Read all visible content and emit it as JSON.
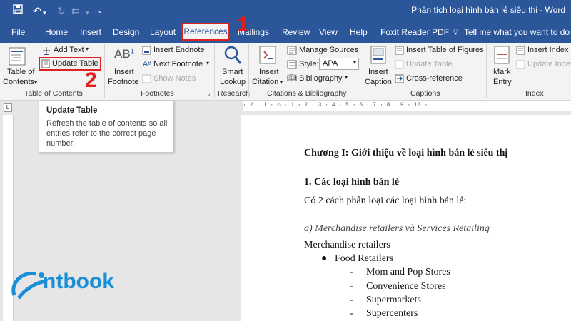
{
  "title_bar": {
    "document_title": "Phân tích loại hình bán lẻ siêu thị  -  Word"
  },
  "tabs": [
    "File",
    "Home",
    "Insert",
    "Design",
    "Layout",
    "References",
    "Mailings",
    "Review",
    "View",
    "Help",
    "Foxit Reader PDF"
  ],
  "tell_me": "Tell me what you want to do",
  "ribbon": {
    "toc": {
      "add_text": "Add Text",
      "update_table": "Update Table",
      "table_of_contents": [
        "Table of",
        "Contents"
      ],
      "group": "Table of Contents"
    },
    "footnotes": {
      "insert_footnote": [
        "Insert",
        "Footnote"
      ],
      "ab_icon": "AB",
      "insert_endnote": "Insert Endnote",
      "next_footnote": "Next Footnote",
      "show_notes": "Show Notes",
      "group": "Footnotes"
    },
    "research": {
      "smart_lookup": [
        "Smart",
        "Lookup"
      ],
      "group": "Research"
    },
    "citations": {
      "insert_citation": [
        "Insert",
        "Citation"
      ],
      "manage_sources": "Manage Sources",
      "style_label": "Style:",
      "style_value": "APA",
      "bibliography": "Bibliography",
      "group": "Citations & Bibliography"
    },
    "captions": {
      "insert_caption": [
        "Insert",
        "Caption"
      ],
      "insert_table_of_figures": "Insert Table of Figures",
      "update_table": "Update Table",
      "cross_reference": "Cross-reference",
      "group": "Captions"
    },
    "index": {
      "mark_entry": [
        "Mark",
        "Entry"
      ],
      "insert_index": "Insert Index",
      "update_index": "Update Index",
      "group": "Index"
    }
  },
  "tooltip": {
    "title": "Update Table",
    "description": "Refresh the table of contents so all entries refer to the correct page number."
  },
  "markers": {
    "step1": "1",
    "step2": "2"
  },
  "ruler_text": "· 2 · 1 · ⌂ · 1 · 2 · 3 · 4 · 5 · 6 · 7 · 8 · 9 · 10 · 1",
  "document": {
    "heading": "Chương I: Giới thiệu về loại hình bán lẻ siêu thị",
    "subheading": "1. Các loại hình bán lẻ",
    "intro": "Có 2 cách phân loại các loại hình bán lẻ:",
    "section_a": "a) Merchandise retailers và Services Retailing",
    "merch": "Merchandise retailers",
    "bullet": "Food Retailers",
    "subitems": [
      "Mom and Pop Stores",
      "Convenience Stores",
      "Supermarkets",
      "Supercenters"
    ]
  },
  "watermark": "ntbook",
  "colors": {
    "word_blue": "#2b579a",
    "highlight_red": "#e02020"
  }
}
